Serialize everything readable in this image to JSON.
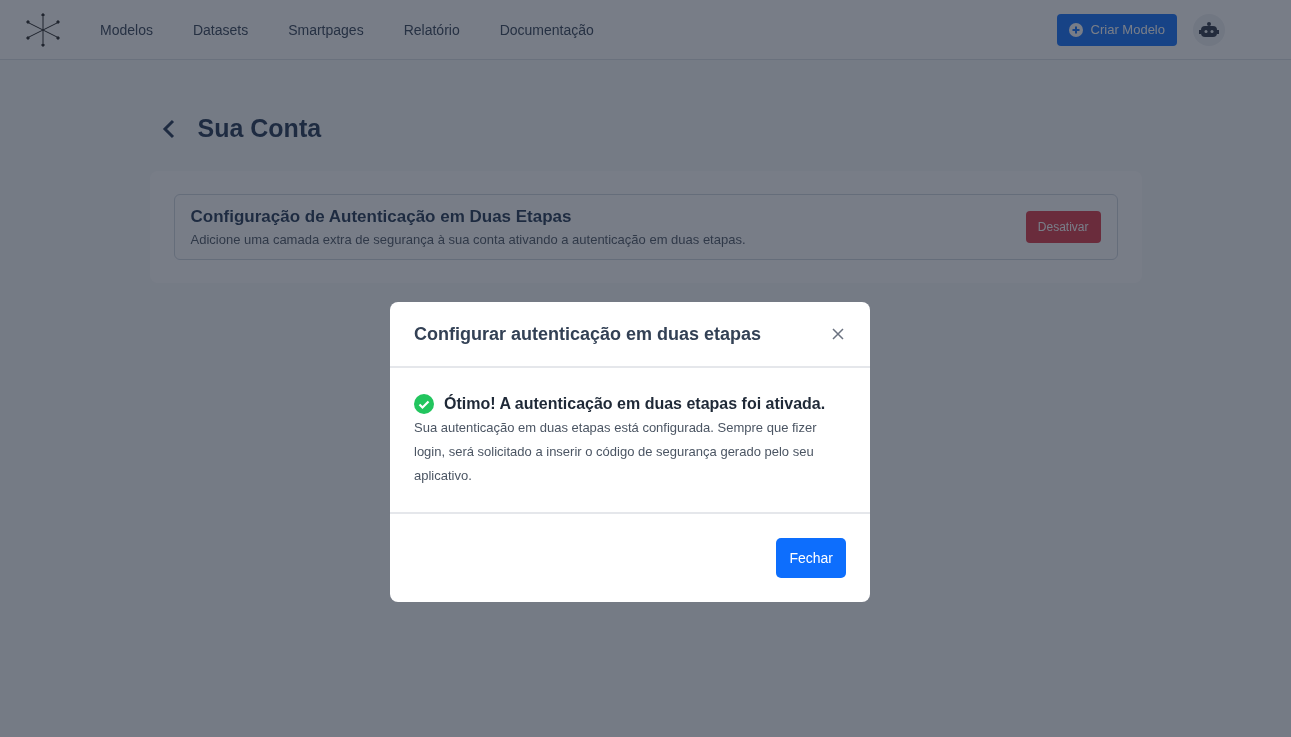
{
  "nav": {
    "items": [
      "Modelos",
      "Datasets",
      "Smartpages",
      "Relatório",
      "Documentação"
    ],
    "create_button": "Criar Modelo"
  },
  "page": {
    "title": "Sua Conta"
  },
  "two_factor_card": {
    "title": "Configuração de Autenticação em Duas Etapas",
    "description": "Adicione uma camada extra de segurança à sua conta ativando a autenticação em duas etapas.",
    "button": "Desativar"
  },
  "modal": {
    "title": "Configurar autenticação em duas etapas",
    "success_title": "Ótimo! A autenticação em duas etapas foi ativada.",
    "success_text": "Sua autenticação em duas etapas está configurada. Sempre que fizer login, será solicitado a inserir o código de segurança gerado pelo seu aplicativo.",
    "close_button": "Fechar"
  }
}
